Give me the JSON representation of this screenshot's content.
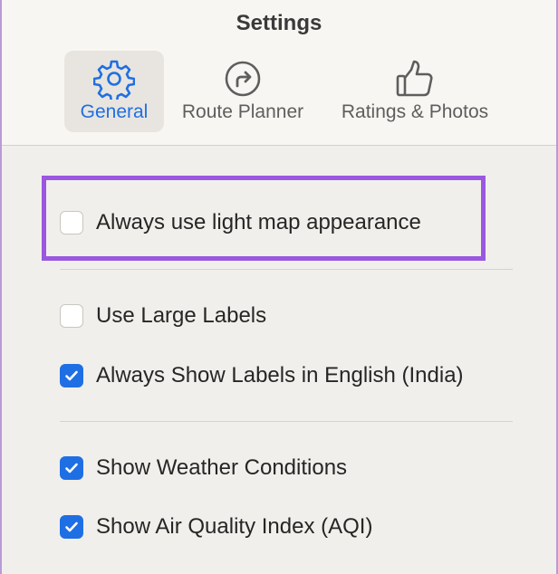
{
  "window": {
    "title": "Settings"
  },
  "tabs": [
    {
      "label": "General",
      "icon": "gear-icon",
      "selected": true
    },
    {
      "label": "Route Planner",
      "icon": "route-arrow-icon",
      "selected": false
    },
    {
      "label": "Ratings & Photos",
      "icon": "thumbs-up-icon",
      "selected": false
    }
  ],
  "options": {
    "light_map": {
      "label": "Always use light map appearance",
      "checked": false
    },
    "large_labels": {
      "label": "Use Large Labels",
      "checked": false
    },
    "labels_english": {
      "label": "Always Show Labels in English (India)",
      "checked": true
    },
    "weather": {
      "label": "Show Weather Conditions",
      "checked": true
    },
    "aqi": {
      "label": "Show Air Quality Index (AQI)",
      "checked": true
    }
  },
  "colors": {
    "accent": "#1f6fe4",
    "highlight": "#9a58e0",
    "background": "#f1efeb"
  }
}
